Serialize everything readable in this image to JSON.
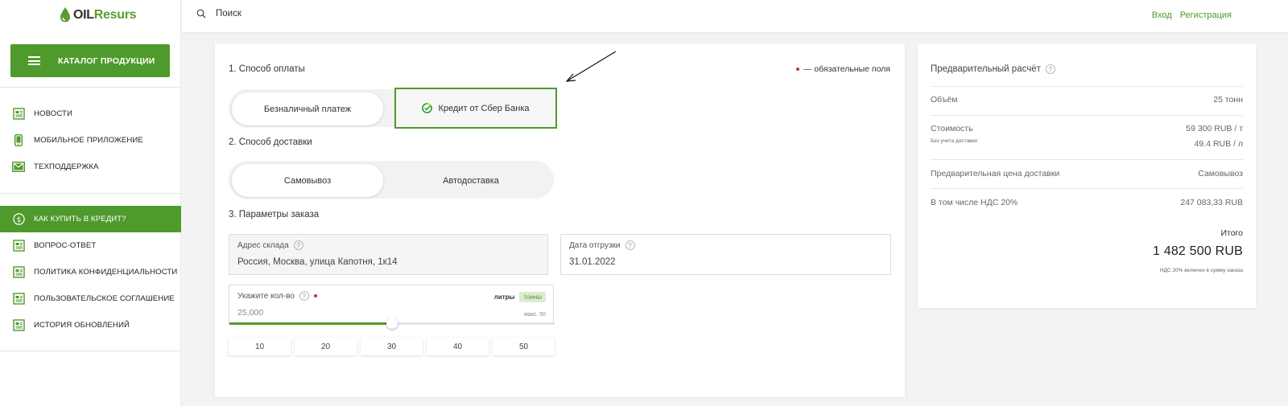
{
  "brand": {
    "logo_oil": "OIL",
    "logo_resurs": "Resurs",
    "accent": "#4f9a2c"
  },
  "sidebar": {
    "catalog_label": "КАТАЛОГ ПРОДУКЦИИ",
    "group1": [
      {
        "label": "НОВОСТИ",
        "icon": "newspaper-icon"
      },
      {
        "label": "МОБИЛЬНОЕ ПРИЛОЖЕНИЕ",
        "icon": "phone-icon"
      },
      {
        "label": "ТЕХПОДДЕРЖКА",
        "icon": "mail-icon"
      }
    ],
    "group2": [
      {
        "label": "КАК КУПИТЬ В КРЕДИТ?",
        "icon": "dollar-coin-icon",
        "active": true
      },
      {
        "label": "ВОПРОС-ОТВЕТ",
        "icon": "document-icon"
      },
      {
        "label": "ПОЛИТИКА КОНФИДЕНЦИАЛЬНОСТИ",
        "icon": "document-icon"
      },
      {
        "label": "ПОЛЬЗОВАТЕЛЬСКОЕ СОГЛАШЕНИЕ",
        "icon": "document-icon"
      },
      {
        "label": "ИСТОРИЯ ОБНОВЛЕНИЙ",
        "icon": "document-icon"
      }
    ]
  },
  "topbar": {
    "search_placeholder": "Поиск",
    "login": "Вход",
    "register": "Регистрация"
  },
  "order": {
    "required_note": "— обязательные поля",
    "payment": {
      "title": "1. Способ оплаты",
      "options": [
        "Безналичный платеж",
        "Кредит от Сбер Банка"
      ],
      "selected": "Кредит от Сбер Банка"
    },
    "delivery": {
      "title": "2. Способ доставки",
      "options": [
        "Самовывоз",
        "Автодоставка"
      ],
      "selected": "Самовывоз"
    },
    "params": {
      "title": "3. Параметры заказа",
      "warehouse_label": "Адрес склада",
      "warehouse_value": "Россия, Москва, улица Капотня, 1к14",
      "ship_date_label": "Дата отгрузки",
      "ship_date_value": "31.01.2022",
      "qty_label": "Укажите кол-во",
      "qty_value": "25,000",
      "unit_liters": "литры",
      "unit_tons": "тонны",
      "max_note": "макс. 50",
      "slider_fraction": 0.5,
      "presets": [
        "10",
        "20",
        "30",
        "40",
        "50"
      ]
    }
  },
  "summary": {
    "title": "Предварительный расчёт",
    "volume_label": "Объём",
    "volume_value": "25 тонн",
    "cost_label": "Стоимость",
    "cost_note": "Без учета доставки",
    "cost_per_ton": "59 300 RUB / т",
    "cost_per_liter": "49.4 RUB / л",
    "delivery_label": "Предварительная цена доставки",
    "delivery_value": "Самовывоз",
    "vat_label": "В том числе НДС 20%",
    "vat_value": "247 083,33 RUB",
    "total_label": "Итого",
    "total_value": "1 482 500 RUB",
    "total_note": "НДС 20% включен в сумму заказа"
  }
}
